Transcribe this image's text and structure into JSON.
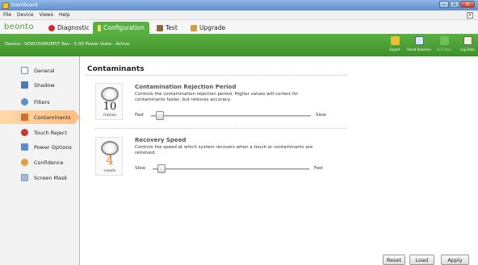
{
  "window": {
    "title": "Dashboard"
  },
  "menu": [
    "File",
    "Device",
    "Views",
    "Help"
  ],
  "logo": "beonto",
  "tabs": [
    {
      "label": "Diagnostic",
      "icon": "heart-icon"
    },
    {
      "label": "Configuration",
      "icon": "wrench-icon",
      "active": true
    },
    {
      "label": "Test",
      "icon": "hammer-icon"
    },
    {
      "label": "Upgrade",
      "icon": "upgrade-icon"
    }
  ],
  "status": "Device : SDW150W2MST Rev : 5.00 Power state : Active",
  "toolbar": [
    {
      "label": "Export",
      "icon": "export-icon",
      "enabled": true
    },
    {
      "label": "Reset Baseline",
      "icon": "reset-baseline-icon",
      "enabled": true
    },
    {
      "label": "LED View",
      "icon": "led-view-icon",
      "enabled": false
    },
    {
      "label": "Log Data",
      "icon": "log-data-icon",
      "enabled": true
    }
  ],
  "sidebar": {
    "items": [
      {
        "label": "General",
        "icon": "general-icon",
        "color": "#6c8fb8"
      },
      {
        "label": "Shadow",
        "icon": "shadow-icon",
        "color": "#4a7ab0"
      },
      {
        "label": "Filters",
        "icon": "filters-icon",
        "color": "#5a8fc8"
      },
      {
        "label": "Contaminants",
        "icon": "contaminants-icon",
        "color": "#d07030",
        "active": true
      },
      {
        "label": "Touch Reject",
        "icon": "touch-reject-icon",
        "color": "#c83a3a"
      },
      {
        "label": "Power Options",
        "icon": "power-options-icon",
        "color": "#5a8fc8"
      },
      {
        "label": "Confidence",
        "icon": "confidence-icon",
        "color": "#e0a040"
      },
      {
        "label": "Screen Mask",
        "icon": "screen-mask-icon",
        "color": "#7a9ac0"
      }
    ]
  },
  "page": {
    "title": "Contaminants",
    "sections": [
      {
        "title": "Contamination Rejection Period",
        "description": "Controls the contamination rejection period.  Higher values will correct for contaminants faster, but reduces accuracy.",
        "icon_value": "10",
        "icon_unit": "frames",
        "slider": {
          "left_label": "Fast",
          "right_label": "Slow",
          "value_fraction": 0.03
        }
      },
      {
        "title": "Recovery Speed",
        "description": "Controls the speed at which system recovers when a touch or contaminants are removed.",
        "icon_value": "4",
        "icon_unit": "counts",
        "slider": {
          "left_label": "Slow",
          "right_label": "Fast",
          "value_fraction": 0.03
        }
      }
    ]
  },
  "buttons": {
    "reset": "Reset",
    "load": "Load",
    "apply": "Apply"
  }
}
